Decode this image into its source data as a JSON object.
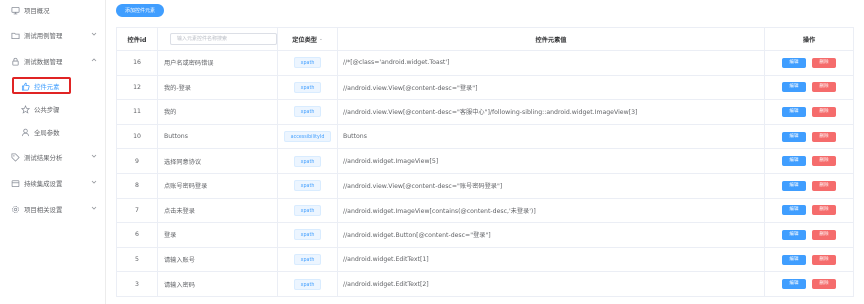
{
  "sidebar": {
    "items": [
      {
        "label": "项目概况",
        "icon": "monitor-icon"
      },
      {
        "label": "测试用例管理",
        "icon": "folder-icon"
      },
      {
        "label": "测试数据管理",
        "icon": "lock-icon"
      },
      {
        "label": "控件元素",
        "icon": "thumbs-up-icon"
      },
      {
        "label": "公共步骤",
        "icon": "star-icon"
      },
      {
        "label": "全局参数",
        "icon": "user-icon"
      },
      {
        "label": "测试结果分析",
        "icon": "tag-icon"
      },
      {
        "label": "持续集成设置",
        "icon": "box-icon"
      },
      {
        "label": "项目相关设置",
        "icon": "gear-icon"
      }
    ]
  },
  "toolbar": {
    "add_label": "添加控件元素"
  },
  "table": {
    "headers": {
      "id": "控件id",
      "search_placeholder": "输入元素控件名称搜索",
      "type": "定位类型",
      "value": "控件元素值",
      "ops": "操作"
    },
    "edit_label": "编辑",
    "delete_label": "删除",
    "rows": [
      {
        "id": "16",
        "name": "用户名或密码错误",
        "type": "xpath",
        "value": "//*[@class='android.widget.Toast']"
      },
      {
        "id": "12",
        "name": "我的-登录",
        "type": "xpath",
        "value": "//android.view.View[@content-desc=\"登录\"]"
      },
      {
        "id": "11",
        "name": "我的",
        "type": "xpath",
        "value": "//android.view.View[@content-desc=\"客服中心\"]/following-sibling::android.widget.ImageView[3]"
      },
      {
        "id": "10",
        "name": "Buttons",
        "type": "accessibilityId",
        "value": "Buttons"
      },
      {
        "id": "9",
        "name": "选择同意协议",
        "type": "xpath",
        "value": "//android.widget.ImageView[5]"
      },
      {
        "id": "8",
        "name": "点账号密码登录",
        "type": "xpath",
        "value": "//android.view.View[@content-desc=\"账号密码登录\"]"
      },
      {
        "id": "7",
        "name": "点击未登录",
        "type": "xpath",
        "value": "//android.widget.ImageView[contains(@content-desc,'未登录')]"
      },
      {
        "id": "6",
        "name": "登录",
        "type": "xpath",
        "value": "//android.widget.Button[@content-desc=\"登录\"]"
      },
      {
        "id": "5",
        "name": "请输入账号",
        "type": "xpath",
        "value": "//android.widget.EditText[1]"
      },
      {
        "id": "3",
        "name": "请输入密码",
        "type": "xpath",
        "value": "//android.widget.EditText[2]"
      }
    ]
  },
  "colors": {
    "accent": "#409eff",
    "danger": "#f56c6c",
    "highlight": "#e02424"
  }
}
